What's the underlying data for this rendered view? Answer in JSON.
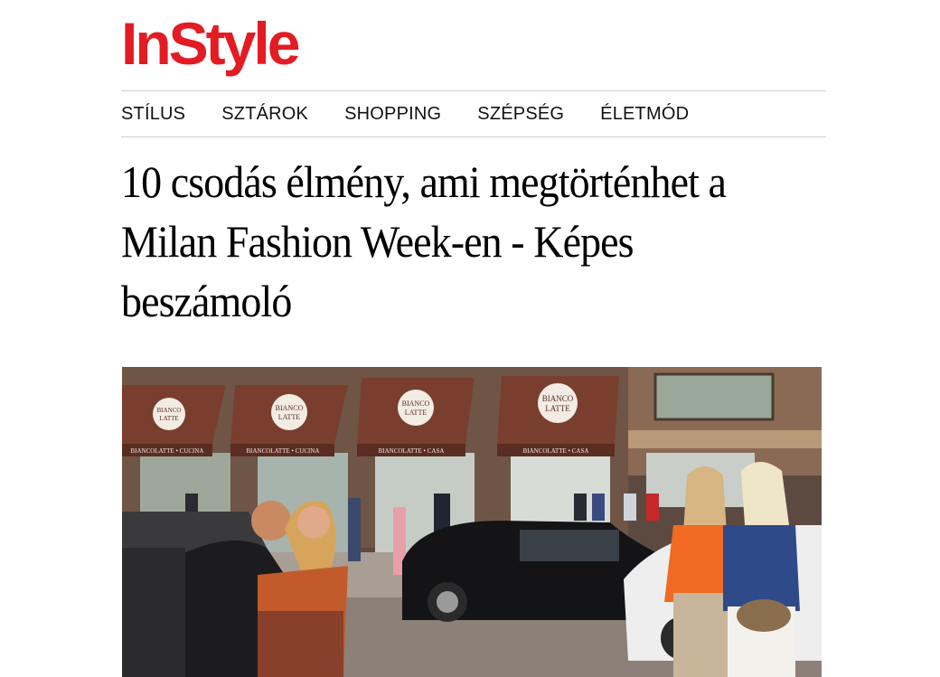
{
  "brand": {
    "logo_text": "InStyle",
    "color": "#e31b23"
  },
  "nav": {
    "items": [
      {
        "label": "STÍLUS"
      },
      {
        "label": "SZTÁROK"
      },
      {
        "label": "SHOPPING"
      },
      {
        "label": "SZÉPSÉG"
      },
      {
        "label": "ÉLETMÓD"
      }
    ]
  },
  "article": {
    "title": "10 csodás élmény, ami megtörténhet a Milan Fashion Week-en - Képes beszámoló"
  },
  "hero_image": {
    "awning_logo": [
      "BIANCO",
      "LATTE"
    ],
    "awning_captions": [
      "BIANCOLATTE • CUCINA",
      "BIANCOLATTE • CUCINA",
      "BIANCOLATTE • CASA",
      "BIANCOLATTE • CASA"
    ]
  }
}
